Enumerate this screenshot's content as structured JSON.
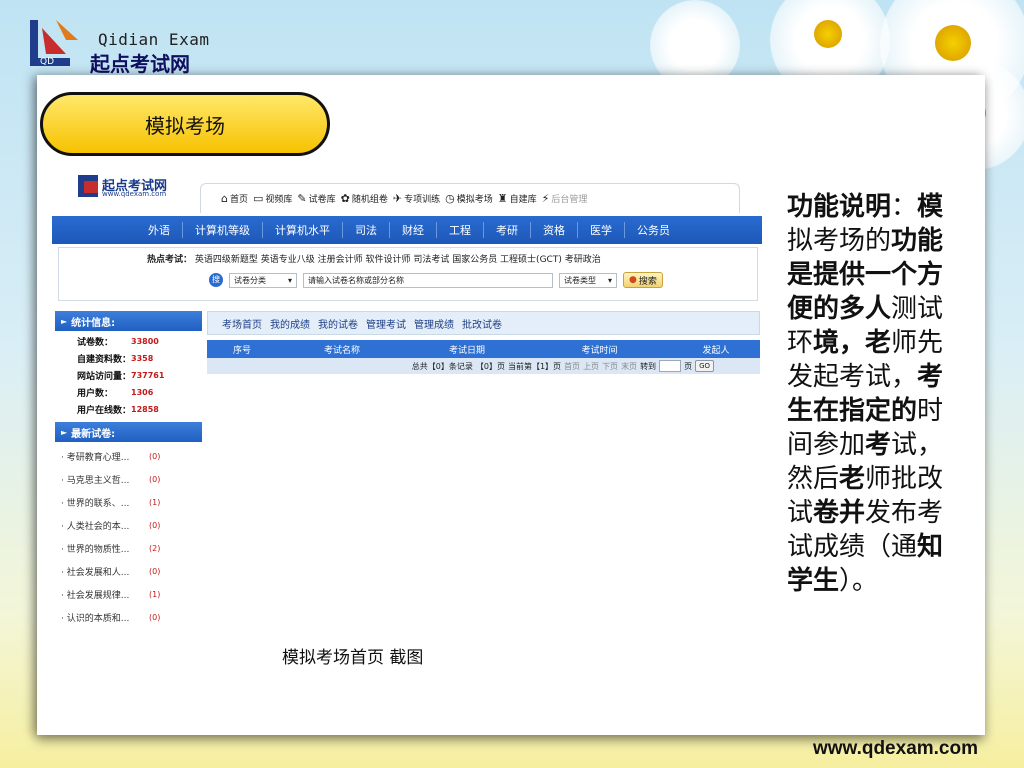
{
  "brand": {
    "en": "Qidian Exam",
    "cn": "起点考试网"
  },
  "slide_title": "模拟考场",
  "caption": "模拟考场首页 截图",
  "footer_url": "www.qdexam.com",
  "side_text": [
    {
      "t": "功能说明",
      "b": true
    },
    {
      "t": "：",
      "b": false
    },
    {
      "t": "模",
      "b": true
    },
    {
      "t": "拟考场的",
      "b": false
    },
    {
      "t": "功能是提供一个方便的多人",
      "b": true
    },
    {
      "t": "测试环",
      "b": false
    },
    {
      "t": "境，老",
      "b": true
    },
    {
      "t": "师先发起考试，",
      "b": false
    },
    {
      "t": "考生在指定的",
      "b": true
    },
    {
      "t": "时间参加",
      "b": false
    },
    {
      "t": "考",
      "b": true
    },
    {
      "t": "试，然后",
      "b": false
    },
    {
      "t": "老",
      "b": true
    },
    {
      "t": "师批改试",
      "b": false
    },
    {
      "t": "卷并",
      "b": true
    },
    {
      "t": "发布考试成绩（通",
      "b": false
    },
    {
      "t": "知学生",
      "b": true
    },
    {
      "t": "）。",
      "b": false
    }
  ],
  "shot": {
    "logo": {
      "title": "起点考试网",
      "sub": "www.qdexam.com"
    },
    "topnav": [
      {
        "icon": "⌂",
        "icon_name": "home-icon",
        "label": "首页",
        "dis": false
      },
      {
        "icon": "▭",
        "icon_name": "monitor-icon",
        "label": "视频库",
        "dis": false
      },
      {
        "icon": "✎",
        "icon_name": "pen-icon",
        "label": "试卷库",
        "dis": false
      },
      {
        "icon": "✿",
        "icon_name": "gear-icon",
        "label": "随机组卷",
        "dis": false
      },
      {
        "icon": "✈",
        "icon_name": "training-icon",
        "label": "专项训练",
        "dis": false
      },
      {
        "icon": "◷",
        "icon_name": "clock-icon",
        "label": "模拟考场",
        "dis": false
      },
      {
        "icon": "♜",
        "icon_name": "shirt-icon",
        "label": "自建库",
        "dis": false
      },
      {
        "icon": "⚡",
        "icon_name": "lightning-icon",
        "label": "后台管理",
        "dis": true
      }
    ],
    "categories": [
      "外语",
      "计算机等级",
      "计算机水平",
      "司法",
      "财经",
      "工程",
      "考研",
      "资格",
      "医学",
      "公务员"
    ],
    "hot_label": "热点考试：",
    "hot_items": "英语四级新题型 英语专业八级 注册会计师 软件设计师 司法考试 国家公务员 工程硕士(GCT) 考研政治",
    "search": {
      "category_select": "试卷分类",
      "input_placeholder": "请输入试卷名称或部分名称",
      "type_select": "试卷类型",
      "button": "搜索"
    },
    "stats_title": "统计信息:",
    "stats": [
      {
        "k": "试卷数：",
        "v": "33800"
      },
      {
        "k": "自建资料数：",
        "v": "3358"
      },
      {
        "k": "网站访问量：",
        "v": "737761"
      },
      {
        "k": "用户数：",
        "v": "1306"
      },
      {
        "k": "用户在线数：",
        "v": "12858"
      }
    ],
    "new_title": "最新试卷:",
    "new_items": [
      {
        "t": "考研教育心理...",
        "c": "(0)"
      },
      {
        "t": "马克思主义哲...",
        "c": "(0)"
      },
      {
        "t": "世界的联系、...",
        "c": "(1)"
      },
      {
        "t": "人类社会的本...",
        "c": "(0)"
      },
      {
        "t": "世界的物质性...",
        "c": "(2)"
      },
      {
        "t": "社会发展和人...",
        "c": "(0)"
      },
      {
        "t": "社会发展规律...",
        "c": "(1)"
      },
      {
        "t": "认识的本质和...",
        "c": "(0)"
      }
    ],
    "tabs": [
      "考场首页",
      "我的成绩",
      "我的试卷",
      "管理考试",
      "管理成绩",
      "批改试卷"
    ],
    "table_headers": [
      "序号",
      "考试名称",
      "考试日期",
      "考试时间",
      "发起人"
    ],
    "pager": {
      "total": "总共【0】条记录",
      "pages": "【0】页",
      "current": "当前第【1】页",
      "first": "首页",
      "prev": "上页",
      "next": "下页",
      "last": "末页",
      "goto": "转到",
      "page_unit": "页",
      "go": "GO"
    }
  }
}
